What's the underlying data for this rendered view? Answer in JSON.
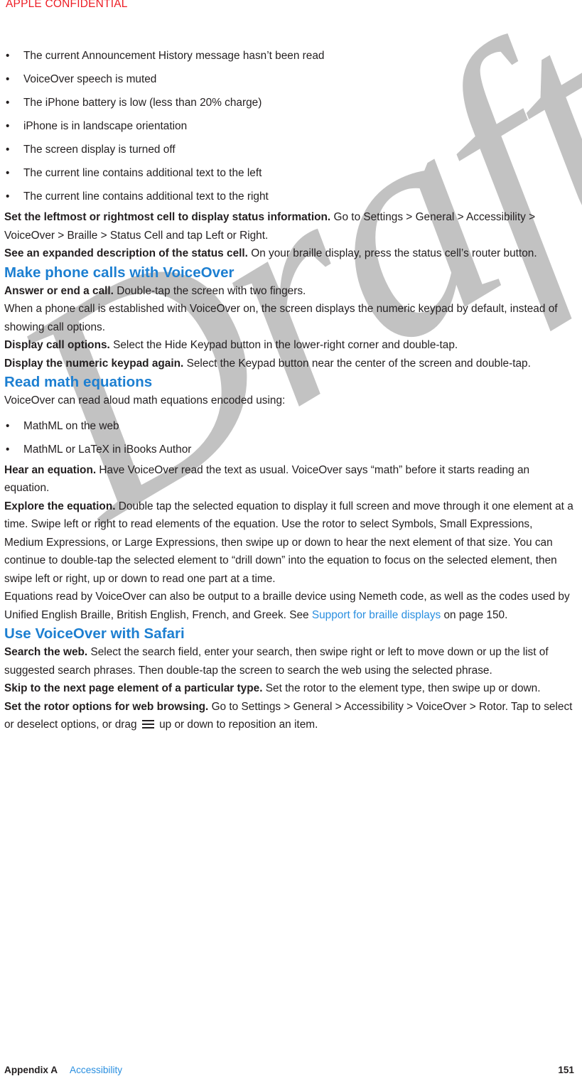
{
  "header": {
    "confidential_notice": "APPLE CONFIDENTIAL"
  },
  "status_conditions": {
    "items": [
      "The current Announcement History message hasn’t been read",
      "VoiceOver speech is muted",
      "The iPhone battery is low (less than 20% charge)",
      "iPhone is in landscape orientation",
      "The screen display is turned off",
      "The current line contains additional text to the left",
      "The current line contains additional text to the right"
    ]
  },
  "braille_tasks": [
    {
      "lead": "Set the leftmost or rightmost cell to display status information.",
      "body": " Go to Settings > General > Accessibility > VoiceOver > Braille > Status Cell and tap Left or Right."
    },
    {
      "lead": "See an expanded description of the status cell.",
      "body": " On your braille display, press the status cell’s router button."
    }
  ],
  "sections": [
    {
      "heading": "Make phone calls with VoiceOver",
      "paragraphs": [
        {
          "lead": "Answer or end a call.",
          "body": " Double-tap the screen with two fingers."
        },
        {
          "lead": "",
          "body": "When a phone call is established with VoiceOver on, the screen displays the numeric keypad by default, instead of showing call options."
        },
        {
          "lead": "Display call options.",
          "body": " Select the Hide Keypad button in the lower-right corner and double-tap."
        },
        {
          "lead": "Display the numeric keypad again.",
          "body": " Select the Keypad button near the center of the screen and double-tap."
        }
      ]
    },
    {
      "heading": "Read math equations",
      "intro": "VoiceOver can read aloud math equations encoded using:",
      "encodings": [
        "MathML on the web",
        "MathML or LaTeX in iBooks Author"
      ],
      "paragraphs": [
        {
          "lead": "Hear an equation.",
          "body": " Have VoiceOver read the text as usual. VoiceOver says “math” before it starts reading an equation."
        },
        {
          "lead": "Explore the equation.",
          "body": " Double tap the selected equation to display it full screen and move through it one element at a time. Swipe left or right to read elements of the equation. Use the rotor to select Symbols, Small Expressions, Medium Expressions, or Large Expressions, then swipe up or down to hear the next element of that size. You can continue to double-tap the selected element to “drill down” into the equation to focus on the selected element, then swipe left or right, up or down to read one part at a time."
        }
      ],
      "nemeth": {
        "before_link": "Equations read by VoiceOver can also be output to a braille device using Nemeth code, as well as the codes used by Unified English Braille, British English, French, and Greek. See ",
        "link_text": "Support for braille displays",
        "after_link": " on page 150."
      }
    },
    {
      "heading": "Use VoiceOver with Safari",
      "paragraphs": [
        {
          "lead": "Search the web.",
          "body": " Select the search field, enter your search, then swipe right or left to move down or up the list of suggested search phrases. Then double-tap the screen to search the web using the selected phrase."
        },
        {
          "lead": "Skip to the next page element of a particular type.",
          "body": " Set the rotor to the element type, then swipe up or down."
        }
      ],
      "rotor_paragraph": {
        "lead": "Set the rotor options for web browsing.",
        "before_icon": " Go to Settings > General > Accessibility > VoiceOver > Rotor. Tap to select or deselect options, or drag ",
        "icon": "reorder-handle-icon",
        "after_icon": " up or down to reposition an item."
      }
    }
  ],
  "watermark": {
    "text": "Draft",
    "color": "#c2c2c2"
  },
  "footer": {
    "appendix": "Appendix A",
    "chapter": "Accessibility",
    "page_number": "151"
  },
  "colors": {
    "heading_blue": "#1d7fd1",
    "link_blue": "#2a8fe0",
    "confidential_red": "#ed1c24",
    "body_text": "#231f20"
  }
}
